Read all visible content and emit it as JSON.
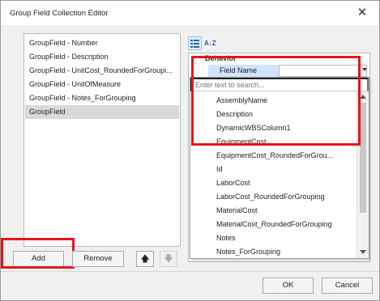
{
  "window": {
    "title": "Group Field Collection Editor",
    "close_glyph": "✕"
  },
  "collection": {
    "items": [
      "GroupField - Number",
      "GroupField - Description",
      "GroupField - UnitCost_RoundedForGroupi...",
      "GroupField - UnitOfMeasure",
      "GroupField - Notes_ForGrouping",
      "GroupField"
    ],
    "selected_index": 5
  },
  "buttons": {
    "add": "Add",
    "remove": "Remove",
    "up": "🡅",
    "down": "🡇",
    "ok": "OK",
    "cancel": "Cancel"
  },
  "property_grid": {
    "sort_alpha_label": "A↓Z",
    "category": "Behavior",
    "property_name": "Field Name",
    "property_value": ""
  },
  "field_dropdown": {
    "search_placeholder": "Enter text to search...",
    "items": [
      {
        "type": "ab",
        "name": "AssemblyName"
      },
      {
        "type": "ab",
        "name": "Description"
      },
      {
        "type": "ab",
        "name": "DynamicWBSColumn1"
      },
      {
        "type": "1.2",
        "name": "EquipmentCost"
      },
      {
        "type": "1.2",
        "name": "EquipmentCost_RoundedForGrou..."
      },
      {
        "type": "id",
        "name": "Id"
      },
      {
        "type": "1.2",
        "name": "LaborCost"
      },
      {
        "type": "1.2",
        "name": "LaborCost_RoundedForGrouping"
      },
      {
        "type": "1.2",
        "name": "MaterialCost"
      },
      {
        "type": "1.2",
        "name": "MaterialCost_RoundedForGrouping"
      },
      {
        "type": "ab",
        "name": "Notes"
      },
      {
        "type": "ab",
        "name": "Notes_ForGrouping"
      }
    ]
  },
  "colors": {
    "highlight": "#e8141c",
    "selection": "#d9d9d9",
    "property_selected": "#cfe4fb"
  }
}
